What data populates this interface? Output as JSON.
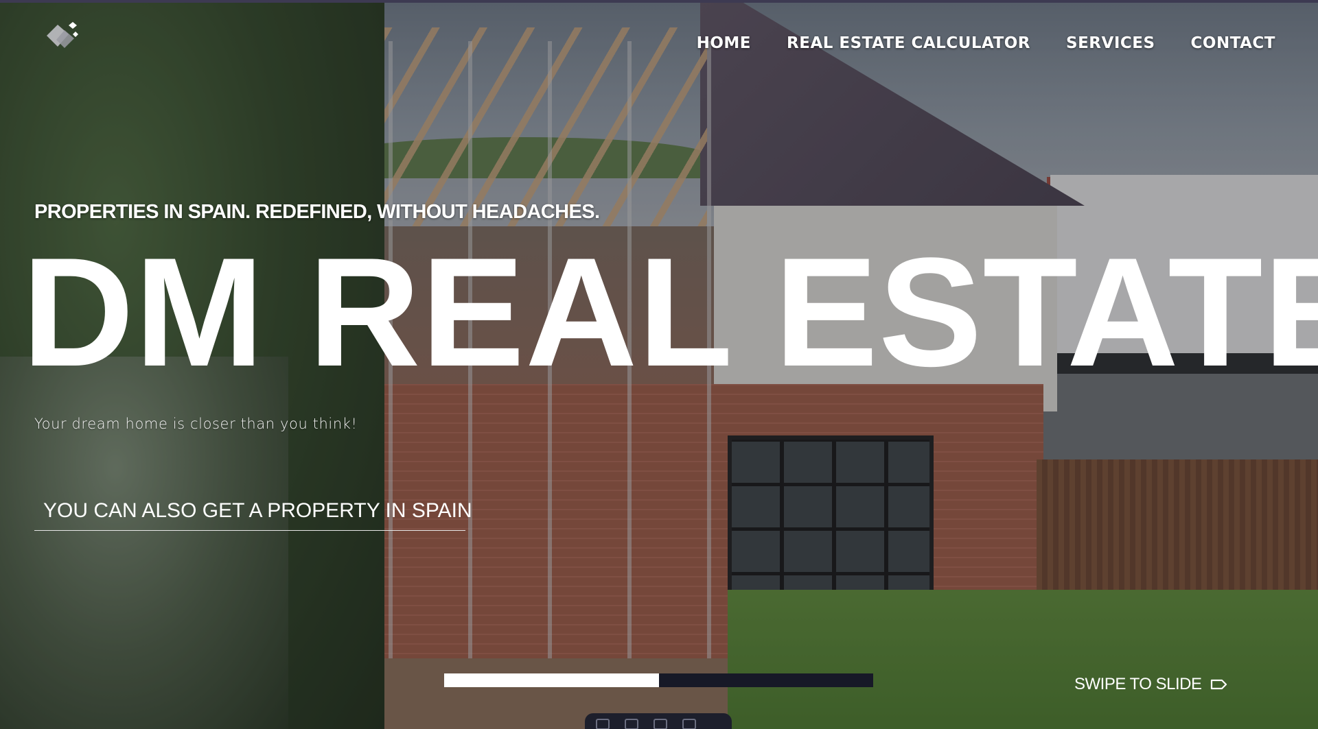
{
  "brand": {
    "logo_icon": "diamond-cube-logo-icon"
  },
  "nav": {
    "items": [
      {
        "label": "HOME"
      },
      {
        "label": "REAL ESTATE CALCULATOR"
      },
      {
        "label": "SERVICES"
      },
      {
        "label": "CONTACT"
      }
    ]
  },
  "hero": {
    "tagline": "PROPERTIES IN SPAIN. REDEFINED, WITHOUT HEADACHES.",
    "title": "DM REAL ESTATE",
    "subtitle": "Your dream home is closer than you think!",
    "cta_label": "YOU CAN ALSO GET A PROPERTY IN SPAIN"
  },
  "slider": {
    "progress": 0.5,
    "swipe_label": "SWIPE TO SLIDE",
    "swipe_icon": "tag-arrow-icon"
  },
  "colors": {
    "progress_track": "#171927",
    "progress_fill": "#ffffff",
    "text": "#ffffff"
  }
}
